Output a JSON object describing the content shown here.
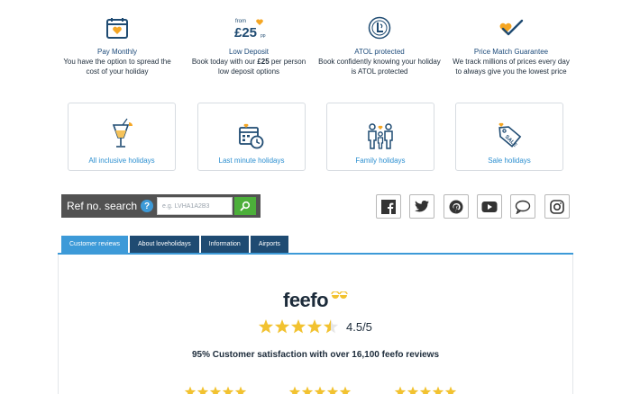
{
  "benefits": [
    {
      "icon": "calendar-heart-icon",
      "title": "Pay Monthly",
      "desc": "You have the option to spread the cost of your holiday"
    },
    {
      "icon": "from-25pp-badge-icon",
      "badge_from": "from",
      "badge_amount": "£25",
      "badge_unit": "pp",
      "title": "Low Deposit",
      "desc_pre": "Book today with our ",
      "desc_bold": "£25",
      "desc_post": " per person low deposit options"
    },
    {
      "icon": "atol-logo-icon",
      "title": "ATOL protected",
      "desc": "Book confidently knowing your holiday is ATOL protected"
    },
    {
      "icon": "heart-check-icon",
      "title": "Price Match Guarantee",
      "desc": "We track millions of prices every day to always give you the lowest price"
    }
  ],
  "categories": [
    {
      "icon": "cocktail-icon",
      "label": "All inclusive holidays"
    },
    {
      "icon": "calendar-clock-icon",
      "label": "Last minute holidays"
    },
    {
      "icon": "family-icon",
      "label": "Family holidays"
    },
    {
      "icon": "sale-tag-icon",
      "label": "Sale holidays"
    }
  ],
  "ref_search": {
    "label": "Ref no. search",
    "help": "?",
    "placeholder": "e.g. LVHA1A2B3"
  },
  "social": [
    "facebook-icon",
    "twitter-icon",
    "pinterest-icon",
    "youtube-icon",
    "chat-icon",
    "instagram-icon"
  ],
  "tabs": [
    "Customer reviews",
    "About loveholidays",
    "Information",
    "Airports"
  ],
  "feefo": {
    "logo": "feefo",
    "rating": 4.5,
    "rating_text": "4.5/5",
    "summary": "95% Customer satisfaction with over 16,100 feefo reviews"
  },
  "colors": {
    "navy": "#1f4b72",
    "blue": "#3d9ad8",
    "gold": "#f2c230",
    "green": "#4caf3a",
    "orange": "#f5a623"
  }
}
